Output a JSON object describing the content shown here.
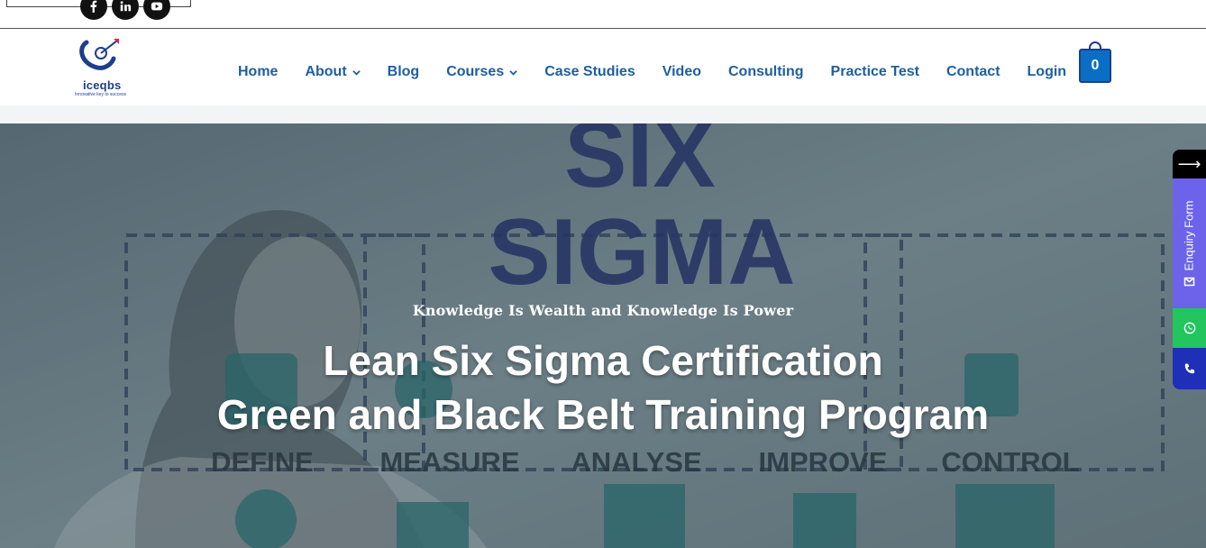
{
  "header": {
    "logo_text": "iceqbs",
    "logo_tagline": "Innovative key to success",
    "cart_count": "0"
  },
  "nav": {
    "items": [
      {
        "label": "Home",
        "has_dropdown": false
      },
      {
        "label": "About",
        "has_dropdown": true
      },
      {
        "label": "Blog",
        "has_dropdown": false
      },
      {
        "label": "Courses",
        "has_dropdown": true
      },
      {
        "label": "Case Studies",
        "has_dropdown": false
      },
      {
        "label": "Video",
        "has_dropdown": false
      },
      {
        "label": "Consulting",
        "has_dropdown": false
      },
      {
        "label": "Practice Test",
        "has_dropdown": false
      },
      {
        "label": "Contact",
        "has_dropdown": false
      },
      {
        "label": "Login",
        "has_dropdown": false
      }
    ]
  },
  "social_icons": [
    "facebook-icon",
    "linkedin-icon",
    "youtube-icon"
  ],
  "hero": {
    "tagline": "Knowledge Is Wealth and Knowledge Is Power",
    "title_line1": "Lean Six Sigma Certification",
    "title_line2": "Green and Black Belt Training Program",
    "bg_word1": "SIX",
    "bg_word2": "SIGMA",
    "phases": [
      "DEFINE",
      "MEASURE",
      "ANALYSE",
      "IMPROVE",
      "CONTROL"
    ]
  },
  "side_panel": {
    "arrow": "⟶",
    "enquiry_label": "Enquiry Form"
  },
  "colors": {
    "nav_text": "#1e5fa0",
    "brand_navy": "#1d3d8f",
    "cart_blue": "#0a6fc4",
    "enquiry_purple": "#6c63ea",
    "whatsapp_green": "#22c55e",
    "phone_blue": "#1f2fb8"
  }
}
